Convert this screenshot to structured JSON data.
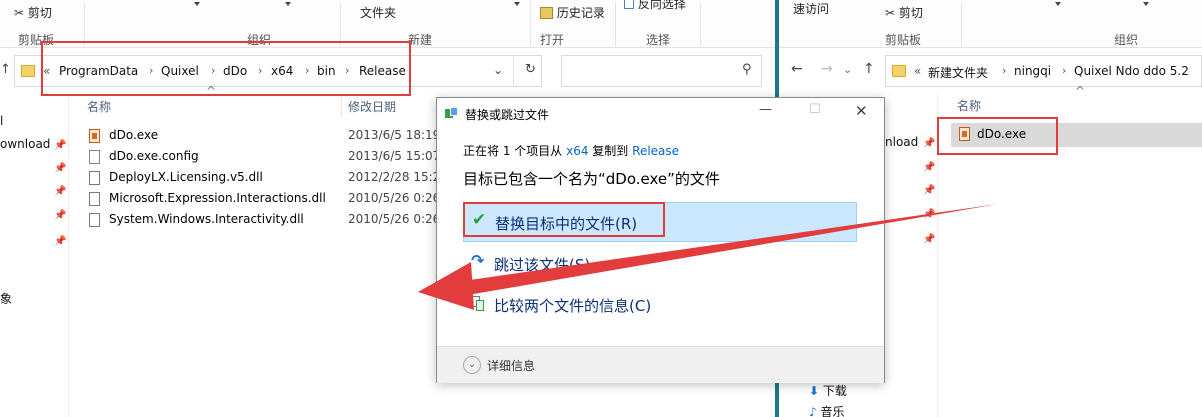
{
  "left_window": {
    "ribbon": {
      "cut_label": "剪切",
      "clipboard_group": "剪贴板",
      "organize_group": "组织",
      "folder_label": "文件夹",
      "new_group": "新建",
      "history_label": "历史记录",
      "open_group": "打开",
      "invert_selection_label": "反向选择",
      "select_group": "选择"
    },
    "breadcrumb": {
      "overflow": "«",
      "items": [
        "ProgramData",
        "Quixel",
        "dDo",
        "x64",
        "bin",
        "Release"
      ]
    },
    "search": {
      "icon": "search-icon"
    },
    "columns": {
      "name": "名称",
      "modified": "修改日期"
    },
    "sidebar": {
      "download_label": "ownload",
      "image_label": "象",
      "other_label": "l"
    },
    "files": [
      {
        "name": "dDo.exe",
        "date": "2013/6/5 18:19",
        "type": "exe"
      },
      {
        "name": "dDo.exe.config",
        "date": "2013/6/5 15:07",
        "type": "config"
      },
      {
        "name": "DeployLX.Licensing.v5.dll",
        "date": "2012/2/28 15:24",
        "type": "dll"
      },
      {
        "name": "Microsoft.Expression.Interactions.dll",
        "date": "2010/5/26 0:26",
        "type": "dll"
      },
      {
        "name": "System.Windows.Interactivity.dll",
        "date": "2010/5/26 0:26",
        "type": "dll"
      }
    ]
  },
  "right_window": {
    "ribbon": {
      "quick_access": "速访问",
      "cut_label": "剪切",
      "clipboard_group": "剪贴板",
      "organize_group": "组织"
    },
    "breadcrumb": {
      "overflow": "«",
      "items": [
        "新建文件夹",
        "ningqi",
        "Quixel Ndo ddo 5.2"
      ]
    },
    "columns": {
      "name": "名称"
    },
    "sidebar": {
      "download_label": "nload",
      "downloads": "下载",
      "music": "音乐"
    },
    "files": [
      {
        "name": "dDo.exe",
        "type": "exe"
      }
    ]
  },
  "dialog": {
    "title": "替换或跳过文件",
    "info": {
      "prefix": "正在将 1 个项目从",
      "source": "x64",
      "middle": "复制到",
      "destination": "Release"
    },
    "heading": "目标已包含一个名为“dDo.exe”的文件",
    "options": [
      {
        "label": "替换目标中的文件(R)",
        "icon": "checkmark-icon"
      },
      {
        "label": "跳过该文件(S)",
        "icon": "skip-arrow-icon"
      },
      {
        "label": "比较两个文件的信息(C)",
        "icon": "compare-icon"
      }
    ],
    "details": "详细信息",
    "colors": {
      "accent": "#0066cc",
      "selected_bg": "#cce8ff",
      "annotation": "#e23c3c"
    }
  }
}
